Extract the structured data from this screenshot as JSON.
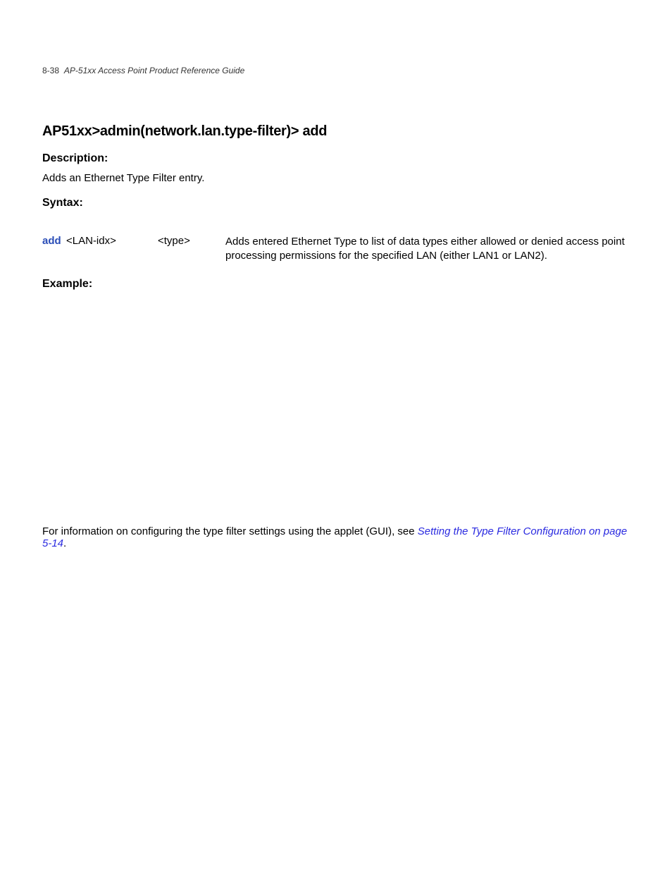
{
  "header": {
    "page_number": "8-38",
    "doc_title": "AP-51xx Access Point Product Reference Guide"
  },
  "command": {
    "title": "AP51xx>admin(network.lan.type-filter)> add"
  },
  "description": {
    "heading": "Description:",
    "text": "Adds an Ethernet Type Filter entry."
  },
  "syntax": {
    "heading": "Syntax:",
    "cmd": "add",
    "arg1": "<LAN-idx>",
    "arg2": "<type>",
    "desc": "Adds entered Ethernet Type to list of data types either allowed or denied access point processing permissions for the specified LAN (either LAN1 or LAN2)."
  },
  "example": {
    "heading": "Example:"
  },
  "footer": {
    "text": "For information on configuring the type filter settings using the applet (GUI), see ",
    "link": "Setting the Type Filter Configuration on page 5-14",
    "period": "."
  }
}
